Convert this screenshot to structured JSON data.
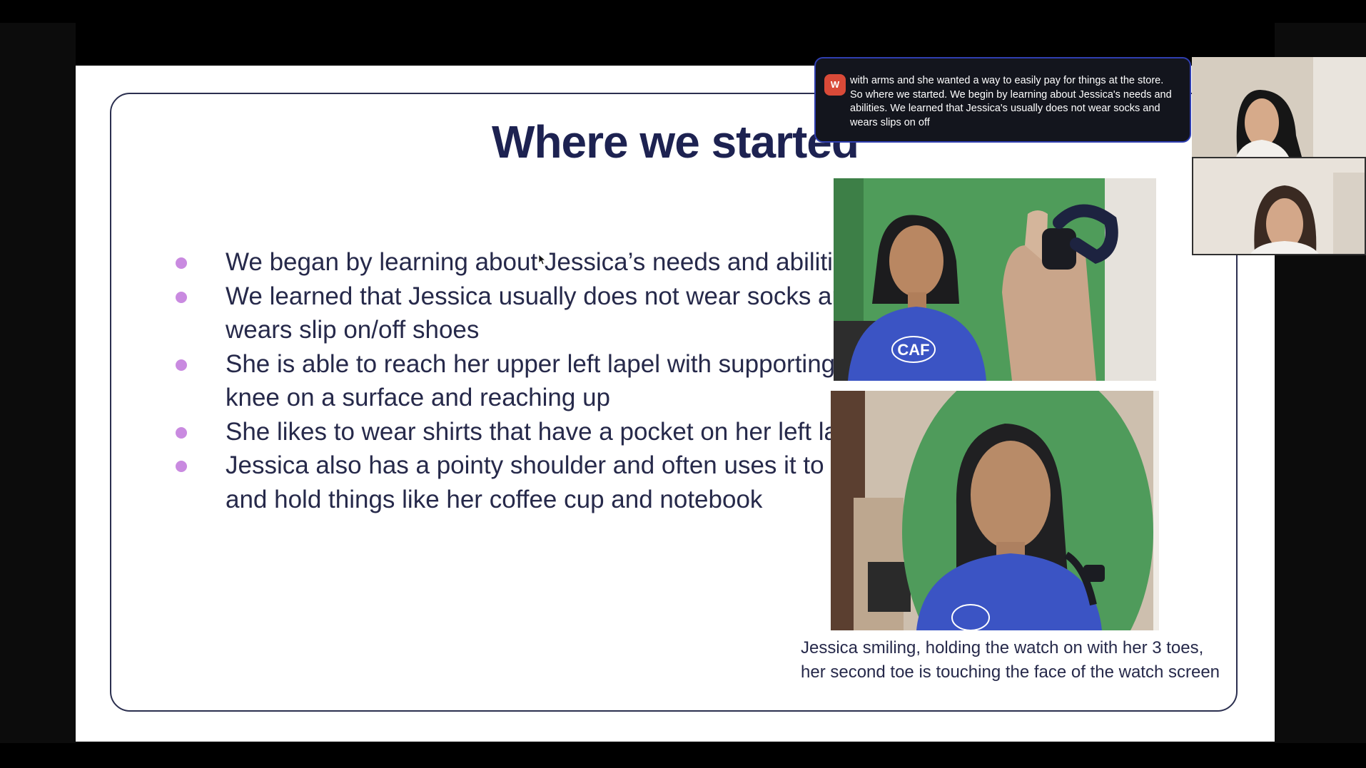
{
  "slide": {
    "title": "Where we started",
    "bullets": [
      "We began by learning about Jessica’s needs and abilities",
      "We learned that Jessica usually does not wear socks and wears slip on/off shoes",
      "She is able to reach her upper left lapel with supporting her knee on a surface and reaching up",
      "She likes to wear shirts that have a pocket on her left lapel",
      "Jessica also has a pointy shoulder and often uses it to grab and hold things like her coffee cup and notebook"
    ],
    "bullet_color": "#c98ae0",
    "title_color": "#1d2251",
    "photo_caption": "Jessica smiling, holding the watch on with her 3 toes, her second toe is touching the face of the watch screen",
    "photo_top_shirt_logo": "CAF"
  },
  "caption_toast": {
    "avatar_letter": "W",
    "text": "with arms and she wanted a way to easily pay for things at the store. So where we started. We begin by learning about Jessica's needs and abilities. We learned that Jessica's usually does not wear socks and wears slips on off",
    "border_color": "#2f3eb0"
  },
  "participants": {
    "tiles": [
      {
        "icon": "participant-video-icon"
      },
      {
        "icon": "participant-video-icon"
      }
    ]
  }
}
